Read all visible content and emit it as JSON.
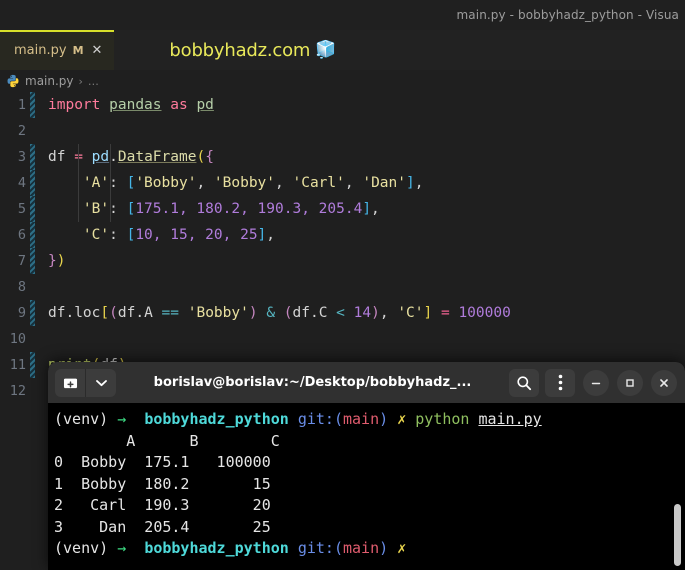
{
  "window": {
    "title": "main.py - bobbyhadz_python - Visua"
  },
  "tabs": [
    {
      "label": "main.py",
      "dirty_marker": "M",
      "close_icon": "✕"
    }
  ],
  "watermark": {
    "text": "bobbyhadz.com",
    "cube_icon": "🧊"
  },
  "breadcrumb": {
    "file": "main.py",
    "separator": "›",
    "ellipsis": "…"
  },
  "editor": {
    "lines": [
      {
        "n": "1",
        "modified": true
      },
      {
        "n": "2",
        "modified": false
      },
      {
        "n": "3",
        "modified": true
      },
      {
        "n": "4",
        "modified": true
      },
      {
        "n": "5",
        "modified": true
      },
      {
        "n": "6",
        "modified": true
      },
      {
        "n": "7",
        "modified": true
      },
      {
        "n": "8",
        "modified": false
      },
      {
        "n": "9",
        "modified": true
      },
      {
        "n": "10",
        "modified": false
      },
      {
        "n": "11",
        "modified": true
      },
      {
        "n": "12",
        "modified": false
      }
    ],
    "code": {
      "l1_import": "import",
      "l1_pandas": "pandas",
      "l1_as": "as",
      "l1_pd": "pd",
      "l3_df": "df",
      "l3_eq": "=",
      "l3_pd": "pd",
      "l3_dot": ".",
      "l3_dataframe": "DataFrame",
      "l3_paren": "(",
      "l3_brace": "{",
      "l4_indent": "    ",
      "l4_key": "'A'",
      "l4_colon": ":",
      "l4_obrk": "[",
      "l4_v1": "'Bobby'",
      "l4_c1": ", ",
      "l4_v2": "'Bobby'",
      "l4_c2": ", ",
      "l4_v3": "'Carl'",
      "l4_c3": ", ",
      "l4_v4": "'Dan'",
      "l4_cbrk": "]",
      "l4_comma": ",",
      "l5_key": "'B'",
      "l5_nums": "175.1, 180.2, 190.3, 205.4",
      "l6_key": "'C'",
      "l6_nums": "10, 15, 20, 25",
      "l7_brace": "}",
      "l7_paren": ")",
      "l9_df": "df",
      "l9_dot": ".",
      "l9_loc": "loc",
      "l9_obrk": "[",
      "l9_op1": "(",
      "l9_dfA": "df.A",
      "l9_eqeq": "==",
      "l9_bobby": "'Bobby'",
      "l9_cp1": ")",
      "l9_amp": "&",
      "l9_op2": "(",
      "l9_dfC": "df.C",
      "l9_lt": "<",
      "l9_14": "14",
      "l9_cp2": ")",
      "l9_comma": ", ",
      "l9_colC": "'C'",
      "l9_cbrk": "]",
      "l9_assign": "=",
      "l9_val": "100000",
      "l11_print": "print",
      "l11_op": "(",
      "l11_df": "df",
      "l11_cp": ")"
    }
  },
  "terminal": {
    "title": "borislav@borislav:~/Desktop/bobbyhadz_...",
    "new_tab_icon": "⊞",
    "dropdown_icon": "▾",
    "search_icon": "⚲",
    "menu_icon": "⋮",
    "minimize_icon": "–",
    "maximize_icon": "□",
    "close_icon": "✕",
    "prompt": {
      "venv": "(venv)",
      "arrow": "→",
      "dir": "bobbyhadz_python",
      "git": "git:(",
      "branch": "main",
      "git_close": ")",
      "dirty": "✗"
    },
    "command": {
      "program": "python",
      "file": "main.py"
    },
    "output": [
      "        A      B        C",
      "0  Bobby  175.1   100000",
      "1  Bobby  180.2       15",
      "2   Carl  190.3       20",
      "3    Dan  205.4       25"
    ]
  }
}
